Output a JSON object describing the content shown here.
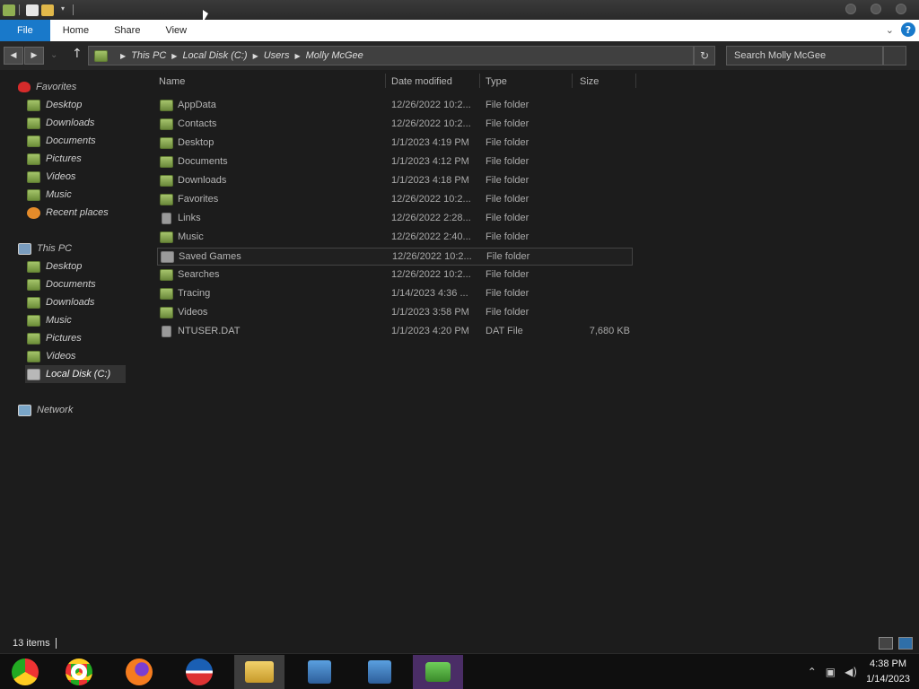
{
  "ribbon": {
    "tabs": [
      "File",
      "Home",
      "Share",
      "View"
    ]
  },
  "address": {
    "crumbs": [
      "This PC",
      "Local Disk (C:)",
      "Users",
      "Molly McGee"
    ],
    "search_placeholder": "Search Molly McGee"
  },
  "sidebar": {
    "favorites_label": "Favorites",
    "favorites": [
      "Desktop",
      "Downloads",
      "Documents",
      "Pictures",
      "Videos",
      "Music",
      "Recent places"
    ],
    "thispc_label": "This PC",
    "thispc": [
      "Desktop",
      "Documents",
      "Downloads",
      "Music",
      "Pictures",
      "Videos",
      "Local Disk (C:)"
    ],
    "network_label": "Network"
  },
  "columns": [
    "Name",
    "Date modified",
    "Type",
    "Size"
  ],
  "files": [
    {
      "name": "AppData",
      "date": "12/26/2022 10:2...",
      "type": "File folder",
      "size": ""
    },
    {
      "name": "Contacts",
      "date": "12/26/2022 10:2...",
      "type": "File folder",
      "size": ""
    },
    {
      "name": "Desktop",
      "date": "1/1/2023 4:19 PM",
      "type": "File folder",
      "size": ""
    },
    {
      "name": "Documents",
      "date": "1/1/2023 4:12 PM",
      "type": "File folder",
      "size": ""
    },
    {
      "name": "Downloads",
      "date": "1/1/2023 4:18 PM",
      "type": "File folder",
      "size": ""
    },
    {
      "name": "Favorites",
      "date": "12/26/2022 10:2...",
      "type": "File folder",
      "size": ""
    },
    {
      "name": "Links",
      "date": "12/26/2022 2:28...",
      "type": "File folder",
      "size": ""
    },
    {
      "name": "Music",
      "date": "12/26/2022 2:40...",
      "type": "File folder",
      "size": ""
    },
    {
      "name": "Saved Games",
      "date": "12/26/2022 10:2...",
      "type": "File folder",
      "size": ""
    },
    {
      "name": "Searches",
      "date": "12/26/2022 10:2...",
      "type": "File folder",
      "size": ""
    },
    {
      "name": "Tracing",
      "date": "1/14/2023 4:36 ...",
      "type": "File folder",
      "size": ""
    },
    {
      "name": "Videos",
      "date": "1/1/2023 3:58 PM",
      "type": "File folder",
      "size": ""
    },
    {
      "name": "NTUSER.DAT",
      "date": "1/1/2023 4:20 PM",
      "type": "DAT File",
      "size": "7,680 KB"
    }
  ],
  "status": {
    "items_count": "13 items"
  },
  "taskbar": {
    "apps": [
      "chrome-os-icon",
      "chrome-icon",
      "firefox-icon",
      "obama-logo-icon",
      "file-explorer-icon",
      "setup-icon",
      "setup-icon",
      "people-icon"
    ],
    "time": "4:38 PM",
    "date": "1/14/2023"
  },
  "colors": {
    "accent": "#1979ca",
    "background": "#1c1c1c",
    "folder": "#8fae52"
  }
}
